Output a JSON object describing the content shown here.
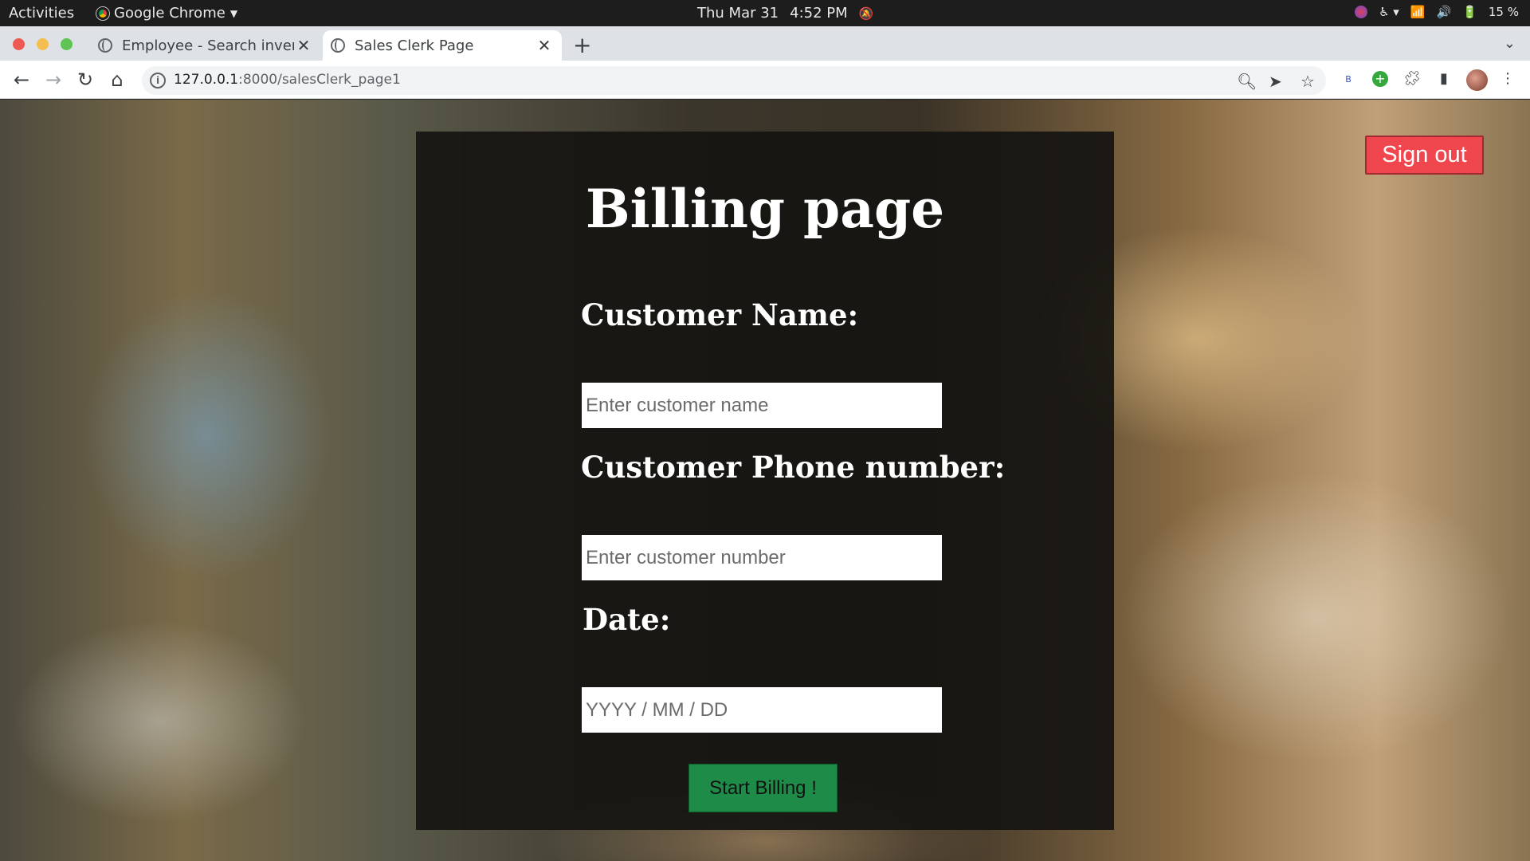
{
  "os_bar": {
    "activities": "Activities",
    "app_name": "Google Chrome",
    "date": "Thu Mar 31",
    "time": "4:52 PM",
    "battery": "15 %"
  },
  "browser": {
    "tabs": [
      {
        "title": "Employee - Search inveno",
        "active": false
      },
      {
        "title": "Sales Clerk Page",
        "active": true
      }
    ],
    "url_host": "127.0.0.1",
    "url_path": ":8000/salesClerk_page1"
  },
  "page": {
    "title": "Billing page",
    "sign_out_label": "Sign out",
    "fields": {
      "name": {
        "label": "Customer Name:",
        "placeholder": "Enter customer name",
        "value": ""
      },
      "phone": {
        "label": "Customer Phone number:",
        "placeholder": "Enter customer number",
        "value": ""
      },
      "date": {
        "label": "Date:",
        "placeholder": "YYYY / MM / DD",
        "value": ""
      }
    },
    "submit_label": "Start Billing !"
  },
  "colors": {
    "sign_out_bg": "#f0474f",
    "submit_bg": "#1e8c48",
    "card_bg": "#161411"
  }
}
